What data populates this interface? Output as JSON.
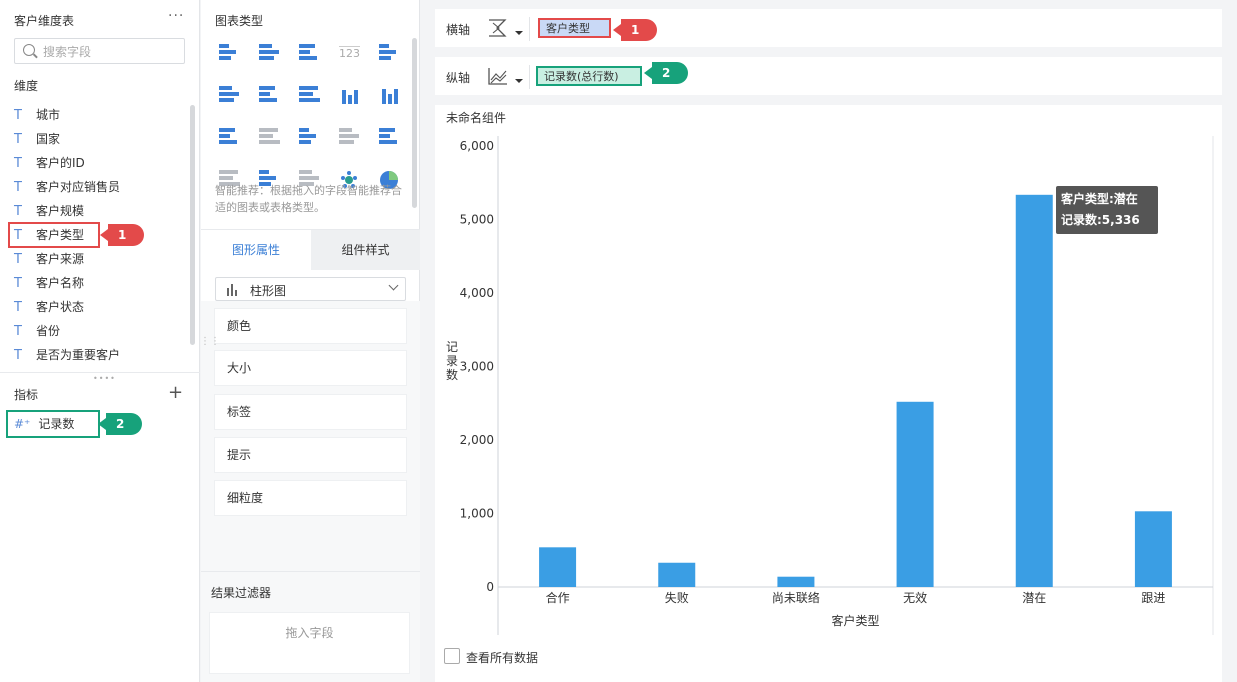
{
  "left_panel": {
    "title": "客户维度表",
    "more": "···",
    "search_placeholder": "搜索字段",
    "dimensions_label": "维度",
    "dimension_type_icon": "T",
    "dimensions": [
      "城市",
      "国家",
      "客户的ID",
      "客户对应销售员",
      "客户规模",
      "客户类型",
      "客户来源",
      "客户名称",
      "客户状态",
      "省份",
      "是否为重要客户"
    ],
    "measures_label": "指标",
    "add": "+",
    "measure_type_icon": "#⁺",
    "measures": [
      "记录数"
    ]
  },
  "middle_panel": {
    "title": "图表类型",
    "hint": "智能推荐：根据拖入的字段智能推荐合适的图表或表格类型。",
    "tabs": {
      "active": "图形属性",
      "inactive": "组件样式"
    },
    "chart_type_select": "柱形图",
    "properties": [
      "颜色",
      "大小",
      "标签",
      "提示",
      "细粒度"
    ],
    "filter_title": "结果过滤器",
    "filter_placeholder": "拖入字段",
    "mini_icon_text": "123"
  },
  "axes": {
    "x_label": "横轴",
    "x_field": "客户类型",
    "y_label": "纵轴",
    "y_field": "记录数(总行数)"
  },
  "badges": {
    "one": "1",
    "two": "2"
  },
  "component_title": "未命名组件",
  "tooltip": {
    "line1": "客户类型:潜在",
    "line2": "记录数:5,336"
  },
  "view_all_label": "查看所有数据",
  "colors": {
    "bar": "#3a9ee4",
    "accent": "#3b7fd6",
    "red": "#e34a4a",
    "green": "#17a27b"
  },
  "chart_data": {
    "type": "bar",
    "categories": [
      "合作",
      "失败",
      "尚未联络",
      "无效",
      "潜在",
      "跟进"
    ],
    "values": [
      540,
      330,
      140,
      2520,
      5336,
      1030
    ],
    "xlabel": "客户类型",
    "ylabel": "记录数",
    "ylim": [
      0,
      6000
    ],
    "yticks": [
      0,
      1000,
      2000,
      3000,
      4000,
      5000,
      6000
    ],
    "ytick_labels": [
      "0",
      "1,000",
      "2,000",
      "3,000",
      "4,000",
      "5,000",
      "6,000"
    ]
  }
}
